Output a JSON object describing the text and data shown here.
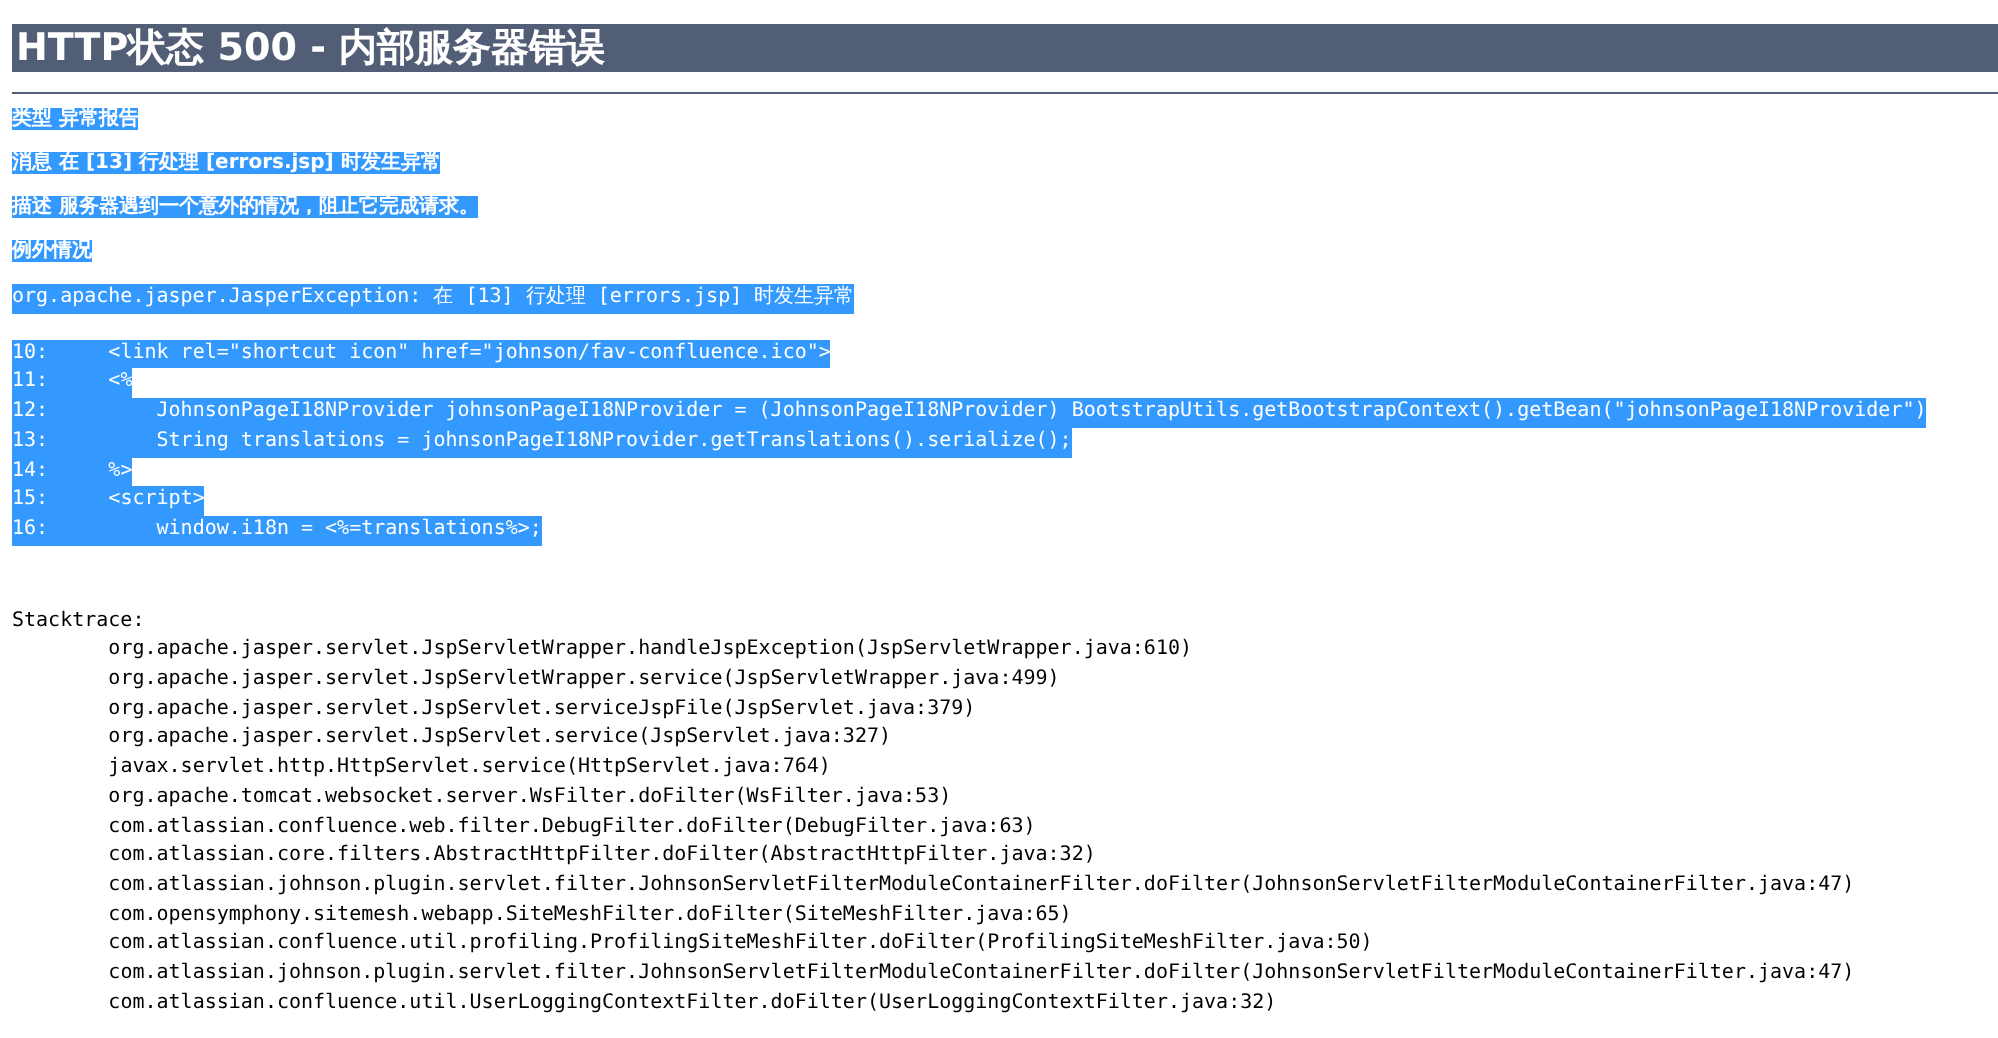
{
  "title": "HTTP状态 500 - 内部服务器错误",
  "report": [
    {
      "text": "类型 异常报告",
      "highlighted": true
    },
    {
      "text": "消息 在 [13] 行处理 [errors.jsp] 时发生异常",
      "highlighted": true
    },
    {
      "text": "描述 服务器遇到一个意外的情况，阻止它完成请求。",
      "highlighted": true
    },
    {
      "text": "例外情况",
      "highlighted": true
    }
  ],
  "exception": {
    "text": "org.apache.jasper.JasperException: 在 [13] 行处理 [errors.jsp] 时发生异常",
    "highlighted": true
  },
  "source_lines": [
    {
      "text": "10:\t<link rel=\"shortcut icon\" href=\"johnson/fav-confluence.ico\">",
      "highlighted": true
    },
    {
      "text": "11:\t<%",
      "highlighted": true
    },
    {
      "text": "12:\t    JohnsonPageI18NProvider johnsonPageI18NProvider = (JohnsonPageI18NProvider) BootstrapUtils.getBootstrapContext().getBean(\"johnsonPageI18NProvider\")",
      "highlighted": true
    },
    {
      "text": "13:\t    String translations = johnsonPageI18NProvider.getTranslations().serialize();",
      "highlighted": true
    },
    {
      "text": "14:\t%>",
      "highlighted": true
    },
    {
      "text": "15:\t<script>",
      "highlighted": true
    },
    {
      "text": "16:\t    window.i18n = <%=translations%>;",
      "highlighted": true
    }
  ],
  "stacktrace": {
    "heading": "Stacktrace:",
    "highlighted": false,
    "frames": [
      "org.apache.jasper.servlet.JspServletWrapper.handleJspException(JspServletWrapper.java:610)",
      "org.apache.jasper.servlet.JspServletWrapper.service(JspServletWrapper.java:499)",
      "org.apache.jasper.servlet.JspServlet.serviceJspFile(JspServlet.java:379)",
      "org.apache.jasper.servlet.JspServlet.service(JspServlet.java:327)",
      "javax.servlet.http.HttpServlet.service(HttpServlet.java:764)",
      "org.apache.tomcat.websocket.server.WsFilter.doFilter(WsFilter.java:53)",
      "com.atlassian.confluence.web.filter.DebugFilter.doFilter(DebugFilter.java:63)",
      "com.atlassian.core.filters.AbstractHttpFilter.doFilter(AbstractHttpFilter.java:32)",
      "com.atlassian.johnson.plugin.servlet.filter.JohnsonServletFilterModuleContainerFilter.doFilter(JohnsonServletFilterModuleContainerFilter.java:47)",
      "com.opensymphony.sitemesh.webapp.SiteMeshFilter.doFilter(SiteMeshFilter.java:65)",
      "com.atlassian.confluence.util.profiling.ProfilingSiteMeshFilter.doFilter(ProfilingSiteMeshFilter.java:50)",
      "com.atlassian.johnson.plugin.servlet.filter.JohnsonServletFilterModuleContainerFilter.doFilter(JohnsonServletFilterModuleContainerFilter.java:47)",
      "com.atlassian.confluence.util.UserLoggingContextFilter.doFilter(UserLoggingContextFilter.java:32)"
    ]
  }
}
